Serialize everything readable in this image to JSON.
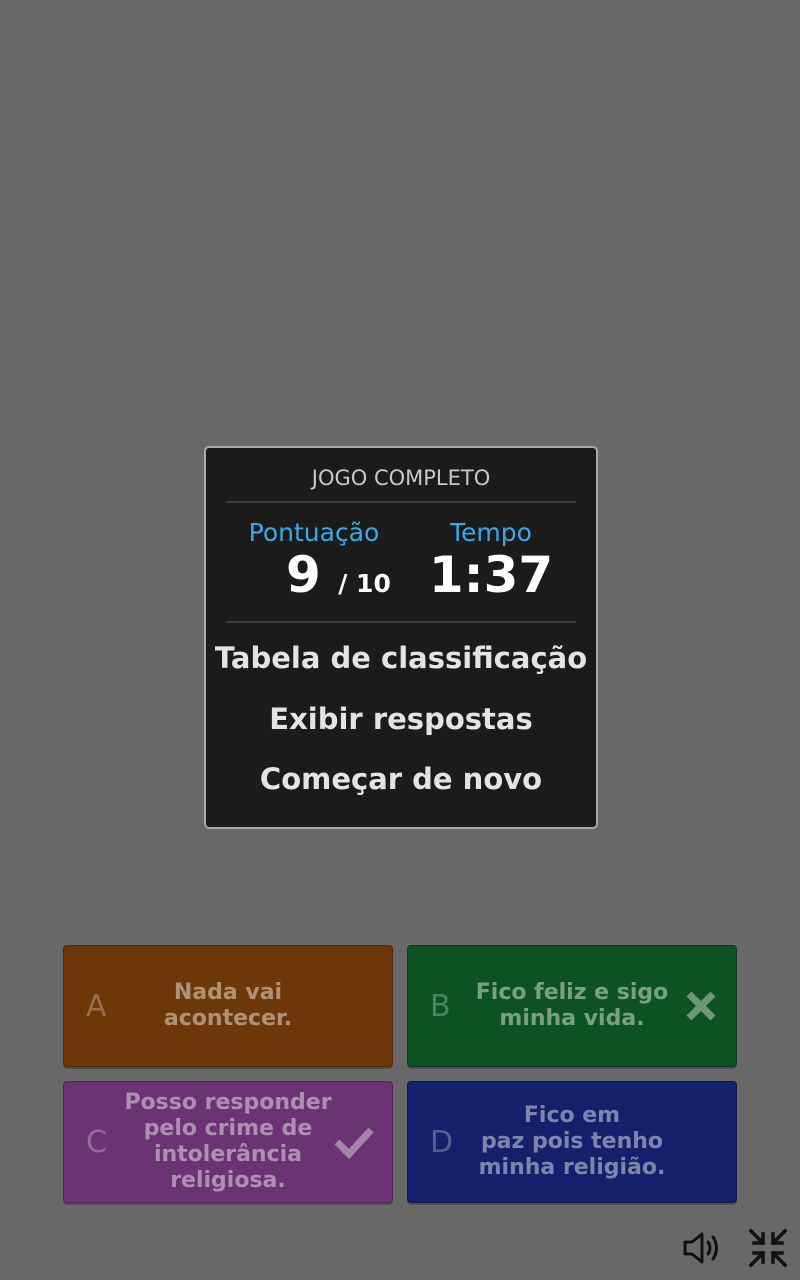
{
  "dialog": {
    "title": "JOGO COMPLETO",
    "score_label": "Pontuação",
    "score": "9",
    "score_total": "/ 10",
    "time_label": "Tempo",
    "time": "1:37",
    "menu": {
      "leaderboard": "Tabela de classificação",
      "show_answers": "Exibir respostas",
      "restart": "Começar de novo"
    }
  },
  "answers": [
    {
      "letter": "A",
      "text": "Nada vai\nacontecer.",
      "color": "#6e3709",
      "result": "none"
    },
    {
      "letter": "B",
      "text": "Fico feliz e sigo\nminha vida.",
      "color": "#0c5222",
      "result": "wrong"
    },
    {
      "letter": "C",
      "text": "Posso responder\npelo crime de\nintolerância\nreligiosa.",
      "color": "#6b3373",
      "result": "correct"
    },
    {
      "letter": "D",
      "text": "Fico em\npaz pois tenho\nminha religião.",
      "color": "#151f6b",
      "result": "none"
    }
  ],
  "controls": {
    "sound_icon": "speaker-icon",
    "collapse_icon": "collapse-fullscreen-icon"
  },
  "colors": {
    "accent": "#39a9ea",
    "overlay": "#686868",
    "dialog_bg": "#1b1b1b"
  }
}
